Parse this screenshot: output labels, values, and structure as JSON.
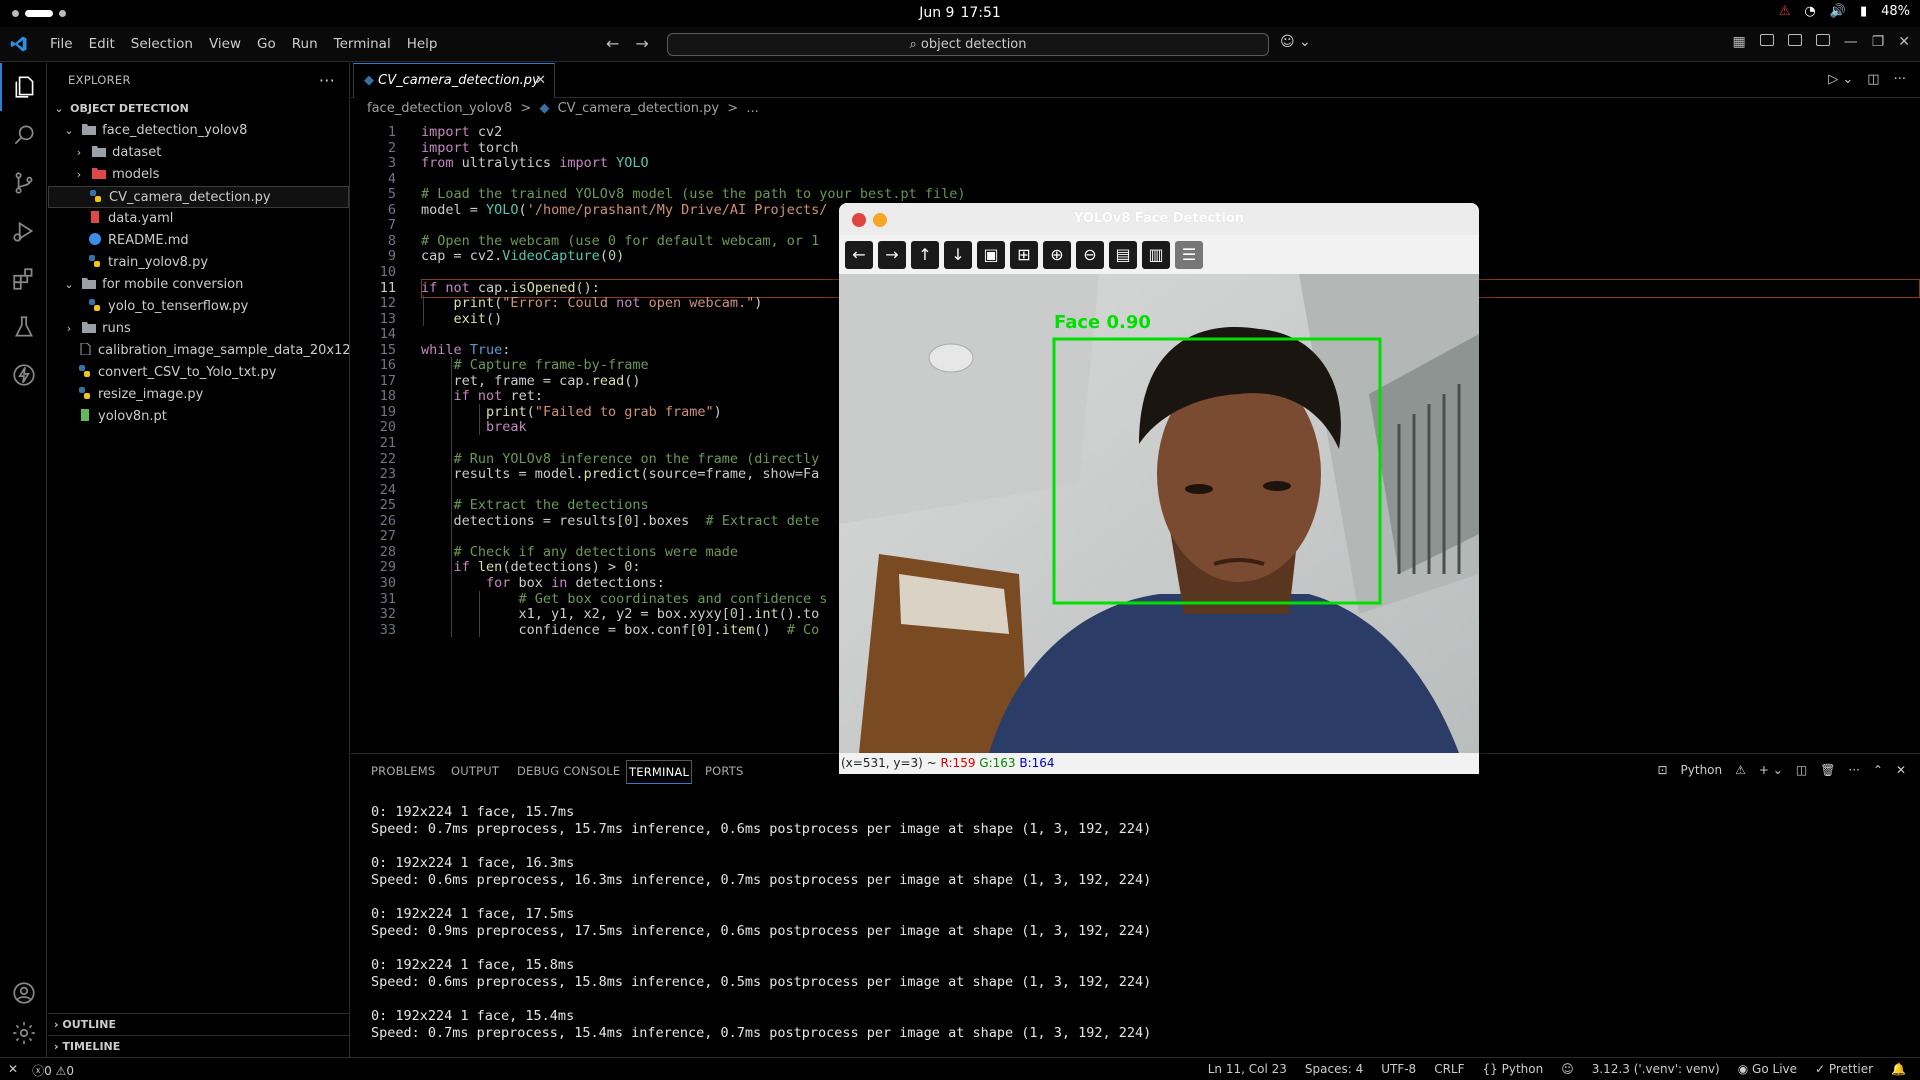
{
  "topbar": {
    "date": "Jun 9",
    "time": "17:51",
    "battery": "48%"
  },
  "titlebar": {
    "menus": [
      "File",
      "Edit",
      "Selection",
      "View",
      "Go",
      "Run",
      "Terminal",
      "Help"
    ],
    "search": "object detection"
  },
  "explorer": {
    "title": "EXPLORER",
    "root": "OBJECT DETECTION",
    "items": [
      {
        "label": "face_detection_yolov8",
        "depth": 1,
        "type": "folder-open"
      },
      {
        "label": "dataset",
        "depth": 2,
        "type": "folder"
      },
      {
        "label": "models",
        "depth": 2,
        "type": "folder-red"
      },
      {
        "label": "CV_camera_detection.py",
        "depth": 2,
        "type": "py"
      },
      {
        "label": "data.yaml",
        "depth": 2,
        "type": "yaml"
      },
      {
        "label": "README.md",
        "depth": 2,
        "type": "info"
      },
      {
        "label": "train_yolov8.py",
        "depth": 2,
        "type": "py"
      },
      {
        "label": "for mobile conversion",
        "depth": 1,
        "type": "folder-open"
      },
      {
        "label": "yolo_to_tenserflow.py",
        "depth": 2,
        "type": "py"
      },
      {
        "label": "runs",
        "depth": 1,
        "type": "folder"
      },
      {
        "label": "calibration_image_sample_data_20x12...",
        "depth": 1,
        "type": "file"
      },
      {
        "label": "convert_CSV_to_Yolo_txt.py",
        "depth": 1,
        "type": "py"
      },
      {
        "label": "resize_image.py",
        "depth": 1,
        "type": "py"
      },
      {
        "label": "yolov8n.pt",
        "depth": 1,
        "type": "pt"
      }
    ],
    "outline": "OUTLINE",
    "timeline": "TIMELINE"
  },
  "editor": {
    "tab": "CV_camera_detection.py",
    "breadcrumb": [
      "face_detection_yolov8",
      ">",
      "CV_camera_detection.py",
      ">",
      "..."
    ],
    "current_line": 11,
    "lines": [
      "import cv2",
      "import torch",
      "from ultralytics import YOLO",
      "",
      "# Load the trained YOLOv8 model (use the path to your best.pt file)",
      "model = YOLO('/home/prashant/My Drive/AI Projects/",
      "",
      "# Open the webcam (use 0 for default webcam, or 1",
      "cap = cv2.VideoCapture(0)",
      "",
      "if not cap.isOpened():",
      "    print(\"Error: Could not open webcam.\")",
      "    exit()",
      "",
      "while True:",
      "    # Capture frame-by-frame",
      "    ret, frame = cap.read()",
      "    if not ret:",
      "        print(\"Failed to grab frame\")",
      "        break",
      "",
      "    # Run YOLOv8 inference on the frame (directly",
      "    results = model.predict(source=frame, show=Fa",
      "",
      "    # Extract the detections",
      "    detections = results[0].boxes  # Extract dete",
      "",
      "    # Check if any detections were made",
      "    if len(detections) > 0:",
      "        for box in detections:",
      "            # Get box coordinates and confidence s",
      "            x1, y1, x2, y2 = box.xyxy[0].int().to",
      "            confidence = box.conf[0].item()  # Co"
    ]
  },
  "panel": {
    "tabs": [
      "PROBLEMS",
      "OUTPUT",
      "DEBUG CONSOLE",
      "TERMINAL",
      "PORTS"
    ],
    "active_tab": "TERMINAL",
    "shell": "Python",
    "terminal": [
      "0: 192x224 1 face, 15.7ms",
      "Speed: 0.7ms preprocess, 15.7ms inference, 0.6ms postprocess per image at shape (1, 3, 192, 224)",
      "",
      "0: 192x224 1 face, 16.3ms",
      "Speed: 0.6ms preprocess, 16.3ms inference, 0.7ms postprocess per image at shape (1, 3, 192, 224)",
      "",
      "0: 192x224 1 face, 17.5ms",
      "Speed: 0.9ms preprocess, 17.5ms inference, 0.6ms postprocess per image at shape (1, 3, 192, 224)",
      "",
      "0: 192x224 1 face, 15.8ms",
      "Speed: 0.6ms preprocess, 15.8ms inference, 0.5ms postprocess per image at shape (1, 3, 192, 224)",
      "",
      "0: 192x224 1 face, 15.4ms",
      "Speed: 0.7ms preprocess, 15.4ms inference, 0.7ms postprocess per image at shape (1, 3, 192, 224)"
    ]
  },
  "statusbar": {
    "errors": "0",
    "warnings": "0",
    "position": "Ln 11, Col 23",
    "spaces": "Spaces: 4",
    "encoding": "UTF-8",
    "eol": "CRLF",
    "language": "Python",
    "interpreter": "3.12.3 ('.venv': venv)",
    "golive": "Go Live",
    "prettier": "Prettier"
  },
  "cv_window": {
    "title": "YOLOv8 Face Detection",
    "detection_label": "Face 0.90",
    "status_prefix": "(x=531, y=3) ~",
    "r": "R:159",
    "g": "G:163",
    "b": "B:164"
  },
  "colors": {
    "accent": "#2d7fd3",
    "bbox": "#00e000"
  }
}
